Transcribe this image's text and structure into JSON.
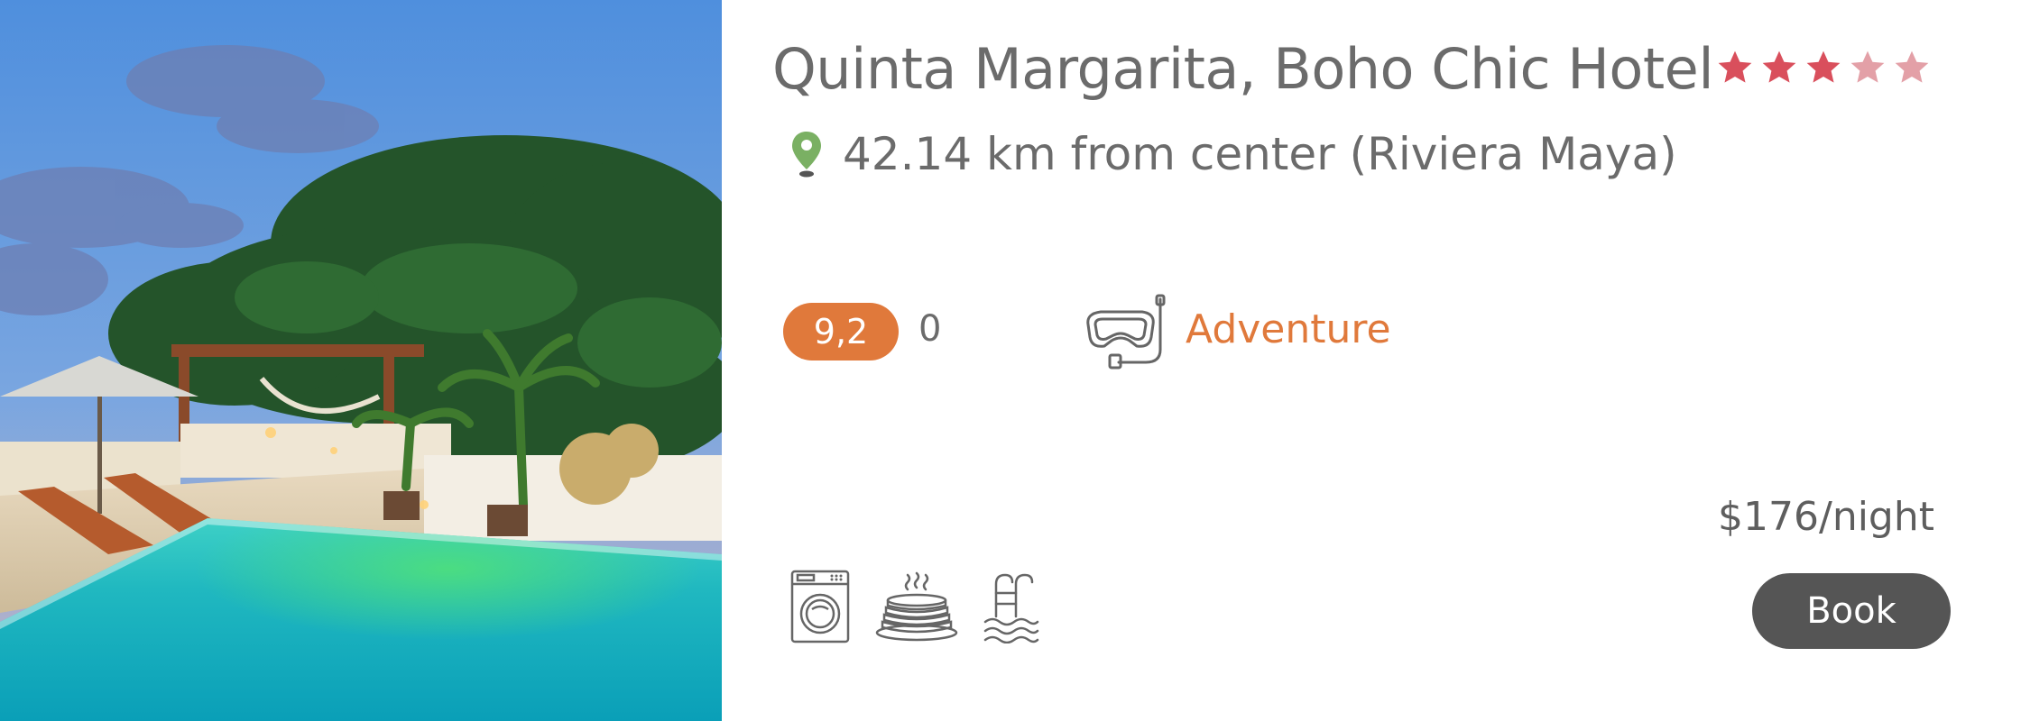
{
  "hotel": {
    "photo_alt": "Rooftop infinity pool",
    "name": "Quinta Margarita, Boho Chic Hotel",
    "stars": {
      "total": 5,
      "filled": 3,
      "partial": 2,
      "filled_color": "#d94f5c",
      "partial_color": "#e3a0a7"
    },
    "location": {
      "icon": "map-pin-icon",
      "text": "42.14 km from center (Riviera Maya)",
      "icon_color": "#7ab063"
    },
    "rating": {
      "score": "9,2",
      "reviews": "0",
      "badge_color": "#e0793b"
    },
    "category": {
      "icon": "snorkel-mask-icon",
      "label": "Adventure",
      "color": "#e0793b"
    },
    "amenities": [
      {
        "name": "laundry",
        "icon": "washing-machine-icon"
      },
      {
        "name": "breakfast",
        "icon": "pancakes-icon"
      },
      {
        "name": "pool",
        "icon": "pool-ladder-icon"
      }
    ],
    "price": "$176/night",
    "book_label": "Book",
    "book_color": "#555555"
  }
}
